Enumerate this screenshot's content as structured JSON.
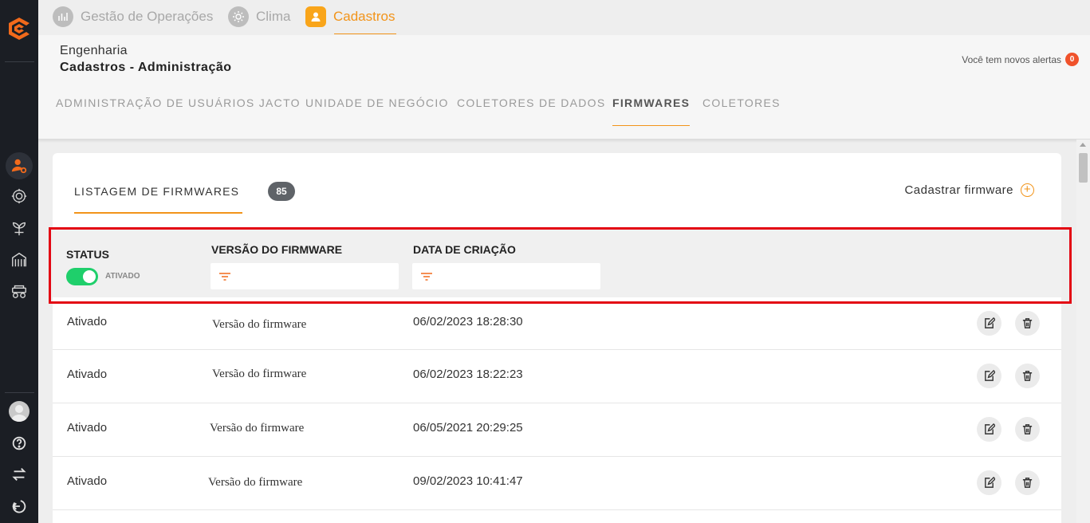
{
  "app_tabs": [
    {
      "label": "Gestão de Operações",
      "icon": "chart-icon"
    },
    {
      "label": "Clima",
      "icon": "sun-icon"
    },
    {
      "label": "Cadastros",
      "icon": "user-icon",
      "active": true
    }
  ],
  "breadcrumb": {
    "line1": "Engenharia",
    "line2": "Cadastros - Administração"
  },
  "alerts": {
    "text": "Você tem novos alertas",
    "count": "0"
  },
  "subtabs": [
    {
      "label": "ADMINISTRAÇÃO DE USUÁRIOS JACTO"
    },
    {
      "label": "UNIDADE DE NEGÓCIO"
    },
    {
      "label": "COLETORES DE DADOS"
    },
    {
      "label": "FIRMWARES",
      "active": true
    },
    {
      "label": "COLETORES"
    }
  ],
  "list": {
    "tab_label": "LISTAGEM DE FIRMWARES",
    "count": "85",
    "add_label": "Cadastrar firmware"
  },
  "columns": {
    "status": "STATUS",
    "version": "VERSÃO DO FIRMWARE",
    "created": "DATA DE CRIAÇÃO"
  },
  "status_filter": {
    "label": "ATIVADO",
    "on": true
  },
  "filter_inputs": {
    "version_placeholder": "",
    "created_placeholder": ""
  },
  "rows": [
    {
      "status": "Ativado",
      "version": "Versão do firmware",
      "created": "06/02/2023 18:28:30"
    },
    {
      "status": "Ativado",
      "version": "Versão do firmware",
      "created": "06/02/2023 18:22:23"
    },
    {
      "status": "Ativado",
      "version": "Versão do firmware",
      "created": "06/05/2021 20:29:25"
    },
    {
      "status": "Ativado",
      "version": "Versão do firmware",
      "created": "09/02/2023 10:41:47"
    }
  ],
  "colors": {
    "accent": "#f2941a",
    "sidebar": "#1b1e24",
    "toggle_on": "#1fcf6b",
    "alert_badge": "#f0522b",
    "highlight": "#e30613"
  },
  "sidebar_icons": [
    "user-settings-icon",
    "gear-network-icon",
    "plant-icon",
    "silo-icon",
    "tractor-icon",
    "avatar",
    "help-icon",
    "swap-icon",
    "logout-icon"
  ]
}
